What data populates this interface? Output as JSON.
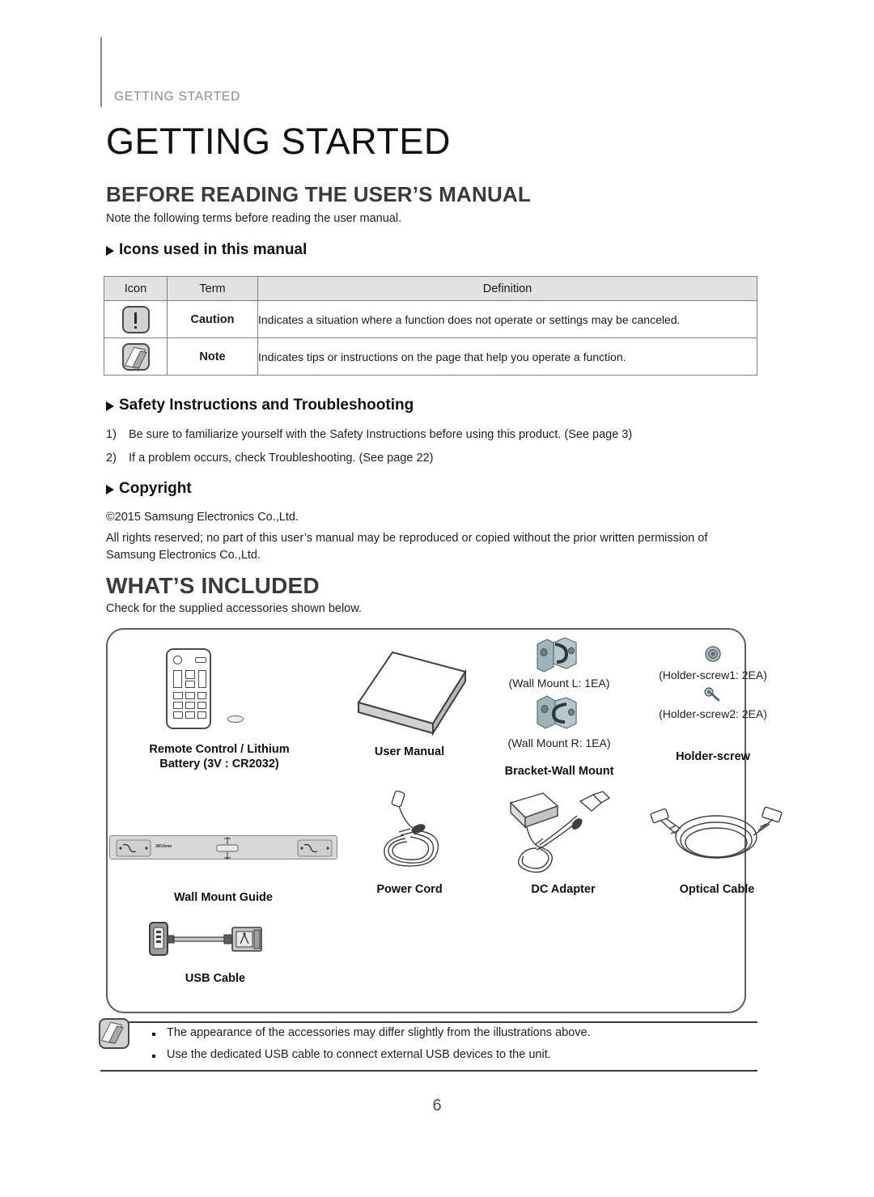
{
  "header": {
    "kicker": "GETTING STARTED",
    "chapter_title": "GETTING STARTED"
  },
  "section1": {
    "heading": "BEFORE READING THE USER’S MANUAL",
    "intro": "Note the following terms before reading the user manual.",
    "sub1_title": "Icons used in this manual",
    "table": {
      "columns": [
        "Icon",
        "Term",
        "Definition"
      ],
      "rows": [
        {
          "icon": "caution-icon",
          "term": "Caution",
          "definition": "Indicates a situation where a function does not operate or settings may be canceled."
        },
        {
          "icon": "note-icon",
          "term": "Note",
          "definition": "Indicates tips or instructions on the page that help you operate a function."
        }
      ]
    },
    "sub2_title": "Safety Instructions and Troubleshooting",
    "numbered": [
      {
        "num": "1)",
        "text": "Be sure to familiarize yourself with the Safety Instructions before using this product. (See page 3)"
      },
      {
        "num": "2)",
        "text": "If a problem occurs, check Troubleshooting. (See page 22)"
      }
    ],
    "sub3_title": "Copyright",
    "copyright_lines": [
      "©2015 Samsung Electronics Co.,Ltd.",
      "All rights reserved; no part of this user’s manual may be reproduced or copied without the prior written permission of",
      "Samsung Electronics Co.,Ltd."
    ]
  },
  "section2": {
    "heading": "WHAT’S INCLUDED",
    "intro": "Check for the supplied accessories shown below.",
    "accessories": [
      {
        "label": "Remote Control / Lithium",
        "label2": "Battery (3V : CR2032)",
        "art": "remote-and-battery"
      },
      {
        "label": "User Manual",
        "art": "manual-book"
      },
      {
        "label": "Bracket-Wall Mount",
        "art": "wall-brackets",
        "sub_labels": [
          "(Wall Mount L: 1EA)",
          "(Wall Mount R: 1EA)"
        ]
      },
      {
        "label": "Holder-screw",
        "art": "screws",
        "sub_labels": [
          "(Holder-screw1: 2EA)",
          "(Holder-screw2: 2EA)"
        ]
      },
      {
        "label": "Wall Mount Guide",
        "art": "wall-mount-guide",
        "guide_dimension": "360.0mm"
      },
      {
        "label": "Power Cord",
        "art": "power-cord"
      },
      {
        "label": "DC Adapter",
        "art": "dc-adapter"
      },
      {
        "label": "Optical Cable",
        "art": "optical-cable"
      },
      {
        "label": "USB Cable",
        "art": "usb-cable"
      }
    ]
  },
  "footer_note": {
    "icon": "note-icon",
    "bullets": [
      "The appearance of the accessories may differ slightly from the illustrations above.",
      "Use the dedicated USB cable to connect external USB devices to the unit."
    ]
  },
  "page_number": "6",
  "colors": {
    "kicker_gray": "#8a8a8a",
    "heading_gray": "#3a3a3a",
    "table_header_bg": "#e2e2e2",
    "rule": "#3a3a3a",
    "bracket_metal": "#8fa5ad"
  }
}
